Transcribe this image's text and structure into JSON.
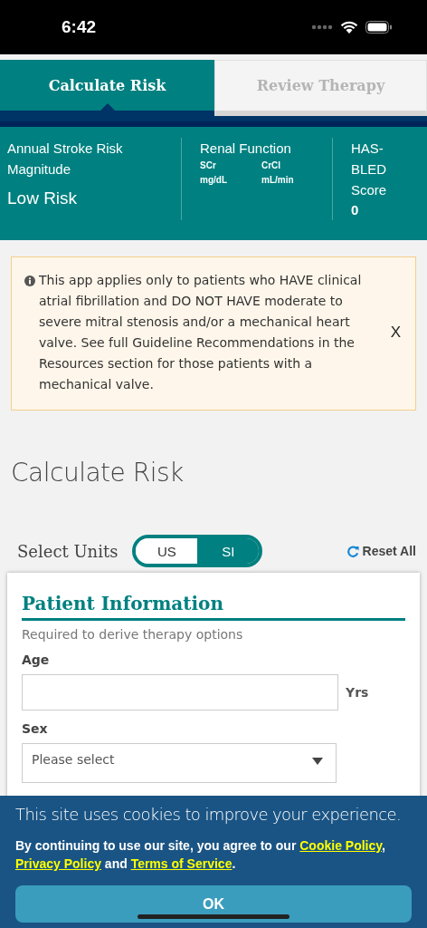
{
  "status_bar": {
    "time": "6:42"
  },
  "tabs": [
    {
      "label": "Calculate Risk",
      "selected": true
    },
    {
      "label": "Review Therapy",
      "selected": false
    }
  ],
  "summary": {
    "stroke_risk": {
      "label": "Annual Stroke Risk Magnitude",
      "value": "Low Risk"
    },
    "renal": {
      "label": "Renal Function",
      "columns": [
        {
          "name": "SCr",
          "unit": "mg/dL"
        },
        {
          "name": "CrCl",
          "unit": "mL/min"
        }
      ]
    },
    "has_bled": {
      "label": "HAS-BLED Score",
      "value": "0"
    }
  },
  "alert": {
    "text": "This app applies only to patients who HAVE clinical atrial fibrillation and DO NOT HAVE moderate to severe mitral stenosis and/or a mechanical heart valve. See full Guideline Recommendations in the Resources section for those patients with a mechanical valve.",
    "close": "X"
  },
  "page_title": "Calculate Risk",
  "units": {
    "label": "Select Units",
    "options": [
      {
        "label": "US",
        "selected": false
      },
      {
        "label": "SI",
        "selected": true
      }
    ],
    "reset": "Reset All"
  },
  "patient_info": {
    "title": "Patient Information",
    "subtitle": "Required to derive therapy options",
    "fields": [
      {
        "kind": "input",
        "label": "Age",
        "unit": "Yrs"
      },
      {
        "kind": "select",
        "label": "Sex",
        "placeholder": "Please select"
      }
    ]
  },
  "cookie": {
    "heading": "This site uses cookies to improve your experience.",
    "segments": [
      {
        "text": "By continuing to use our site, you agree to our ",
        "link": false
      },
      {
        "text": "Cookie Policy",
        "link": true
      },
      {
        "text": ", ",
        "link": false
      },
      {
        "text": "Privacy Policy",
        "link": true
      },
      {
        "text": " and ",
        "link": false
      },
      {
        "text": "Terms of Service",
        "link": true
      },
      {
        "text": ".",
        "link": false
      }
    ],
    "button": "OK"
  }
}
